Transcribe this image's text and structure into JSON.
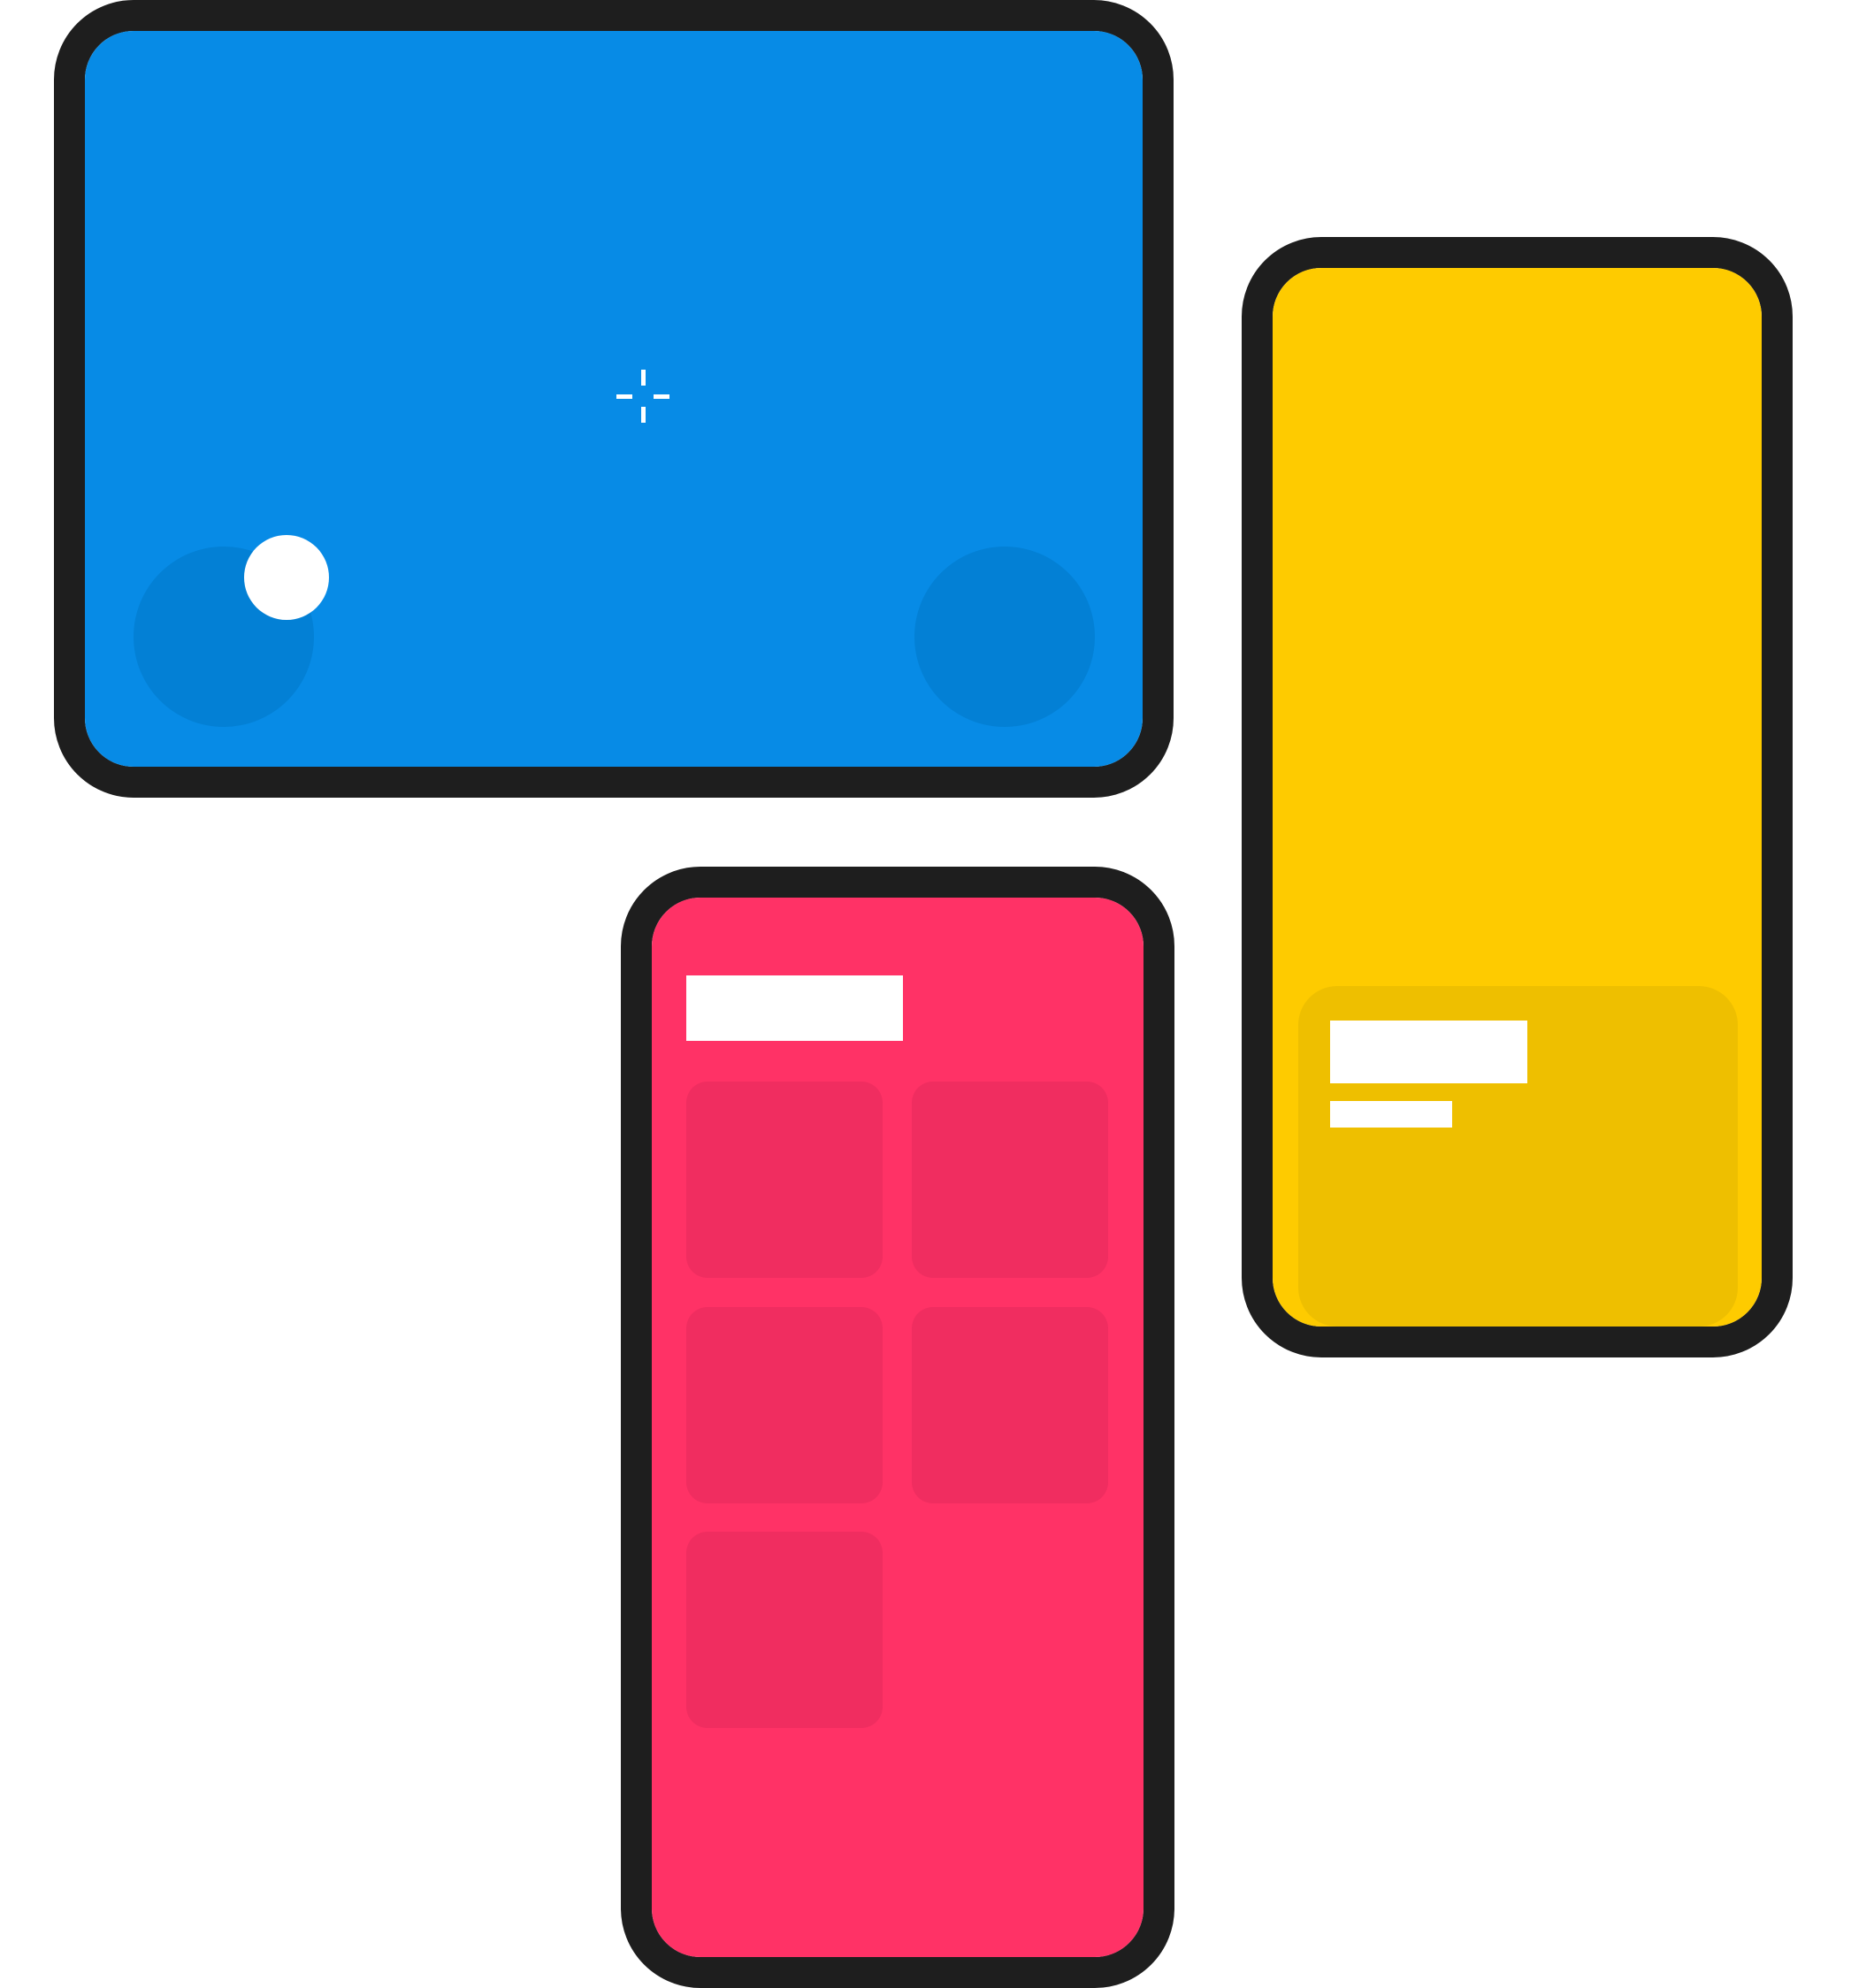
{
  "colors": {
    "frame": "#1e1e1e",
    "blue_screen": "#078be6",
    "blue_control": "#0380d5",
    "yellow_screen": "#fecb00",
    "yellow_sheet": "#eebf00",
    "pink_screen": "#ff3266",
    "pink_tile": "#f02d60",
    "placeholder": "#ffffff"
  },
  "blue_device": {
    "crosshair_icon": "crosshair-icon",
    "left_joystick_knob": {
      "offset_x": 0.24,
      "offset_y": -0.24
    }
  },
  "yellow_device": {
    "sheet_lines": 2
  },
  "pink_device": {
    "header_lines": 1,
    "tile_count": 5
  }
}
